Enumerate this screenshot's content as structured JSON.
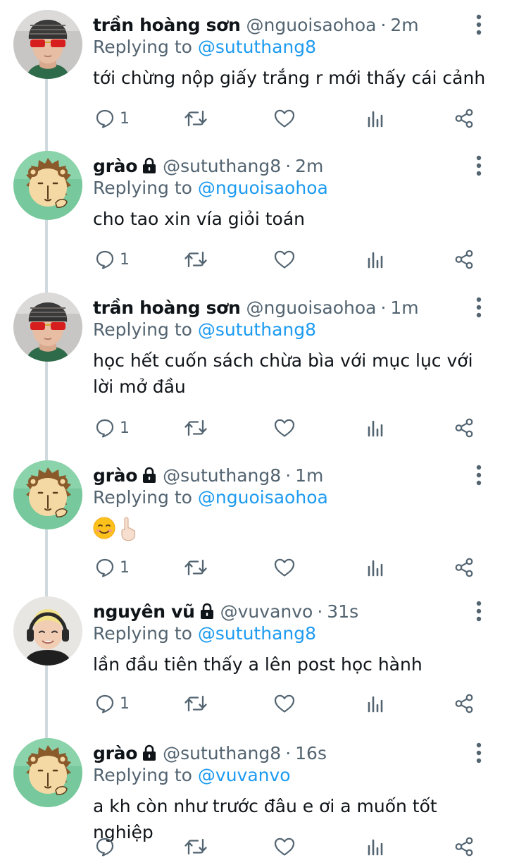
{
  "replying_label": "Replying to",
  "tweets": [
    {
      "name": "trần hoàng sơn",
      "handle": "@nguoisaohoa",
      "separator": "·",
      "time": "2m",
      "reply_to": "@sututhang8",
      "text": "tới chừng nộp giấy trắng r mới thấy cái cảnh",
      "reply_count": "1",
      "avatar_icon": "person-sunglasses-avatar",
      "locked": false
    },
    {
      "name": "grào",
      "handle": "@sututhang8",
      "separator": "·",
      "time": "2m",
      "reply_to": "@nguoisaohoa",
      "text": "cho tao xin vía giỏi toán",
      "reply_count": "1",
      "avatar_icon": "lion-cartoon-avatar",
      "locked": true
    },
    {
      "name": "trần hoàng sơn",
      "handle": "@nguoisaohoa",
      "separator": "·",
      "time": "1m",
      "reply_to": "@sututhang8",
      "text": "học hết cuốn sách chừa bìa với mục lục với lời mở đầu",
      "reply_count": "1",
      "avatar_icon": "person-sunglasses-avatar",
      "locked": false
    },
    {
      "name": "grào",
      "handle": "@sututhang8",
      "separator": "·",
      "time": "1m",
      "reply_to": "@nguoisaohoa",
      "text": "",
      "emojis": [
        "smiling-face-emoji",
        "index-pointing-up-emoji"
      ],
      "reply_count": "1",
      "avatar_icon": "lion-cartoon-avatar",
      "locked": true
    },
    {
      "name": "nguyên vũ",
      "handle": "@vuvanvo",
      "separator": "·",
      "time": "31s",
      "reply_to": "@sututhang8",
      "text": "lần đầu tiên thấy a lên post học hành",
      "reply_count": "1",
      "avatar_icon": "person-headset-avatar",
      "locked": true
    },
    {
      "name": "grào",
      "handle": "@sututhang8",
      "separator": "·",
      "time": "16s",
      "reply_to": "@vuvanvo",
      "text": "a kh còn như trước đâu e ơi a muốn tốt nghiệp",
      "reply_count": "",
      "avatar_icon": "lion-cartoon-avatar",
      "locked": true
    }
  ],
  "icons": {
    "reply": "reply-icon",
    "retweet": "retweet-icon",
    "like": "heart-icon",
    "views": "views-bar-chart-icon",
    "share": "share-icon",
    "more": "more-options-icon",
    "lock": "lock-icon"
  },
  "colors": {
    "link": "#1d9bf0",
    "secondary_text": "#536471",
    "primary_text": "#0f1419",
    "thread_line": "#cfd9de"
  }
}
